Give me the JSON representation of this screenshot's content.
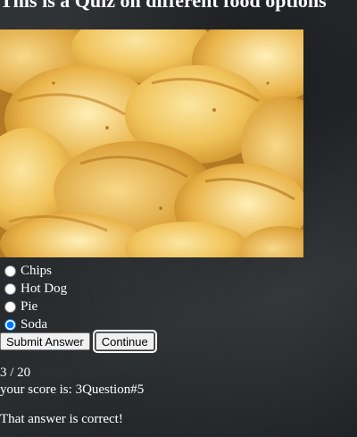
{
  "quiz": {
    "title": "This is a Quiz on different food options",
    "options": [
      {
        "label": "Chips",
        "selected": false
      },
      {
        "label": "Hot Dog",
        "selected": false
      },
      {
        "label": "Pie",
        "selected": false
      },
      {
        "label": "Soda",
        "selected": true
      }
    ],
    "submit_label": "Submit Answer",
    "continue_label": "Continue",
    "progress": "3 / 20",
    "score_text": "your score is: 3Question#5",
    "feedback": "That answer is correct!"
  },
  "image": {
    "subject": "potato chips"
  },
  "colors": {
    "text": "#ffffff",
    "radio_selected": "#1a73e8"
  }
}
